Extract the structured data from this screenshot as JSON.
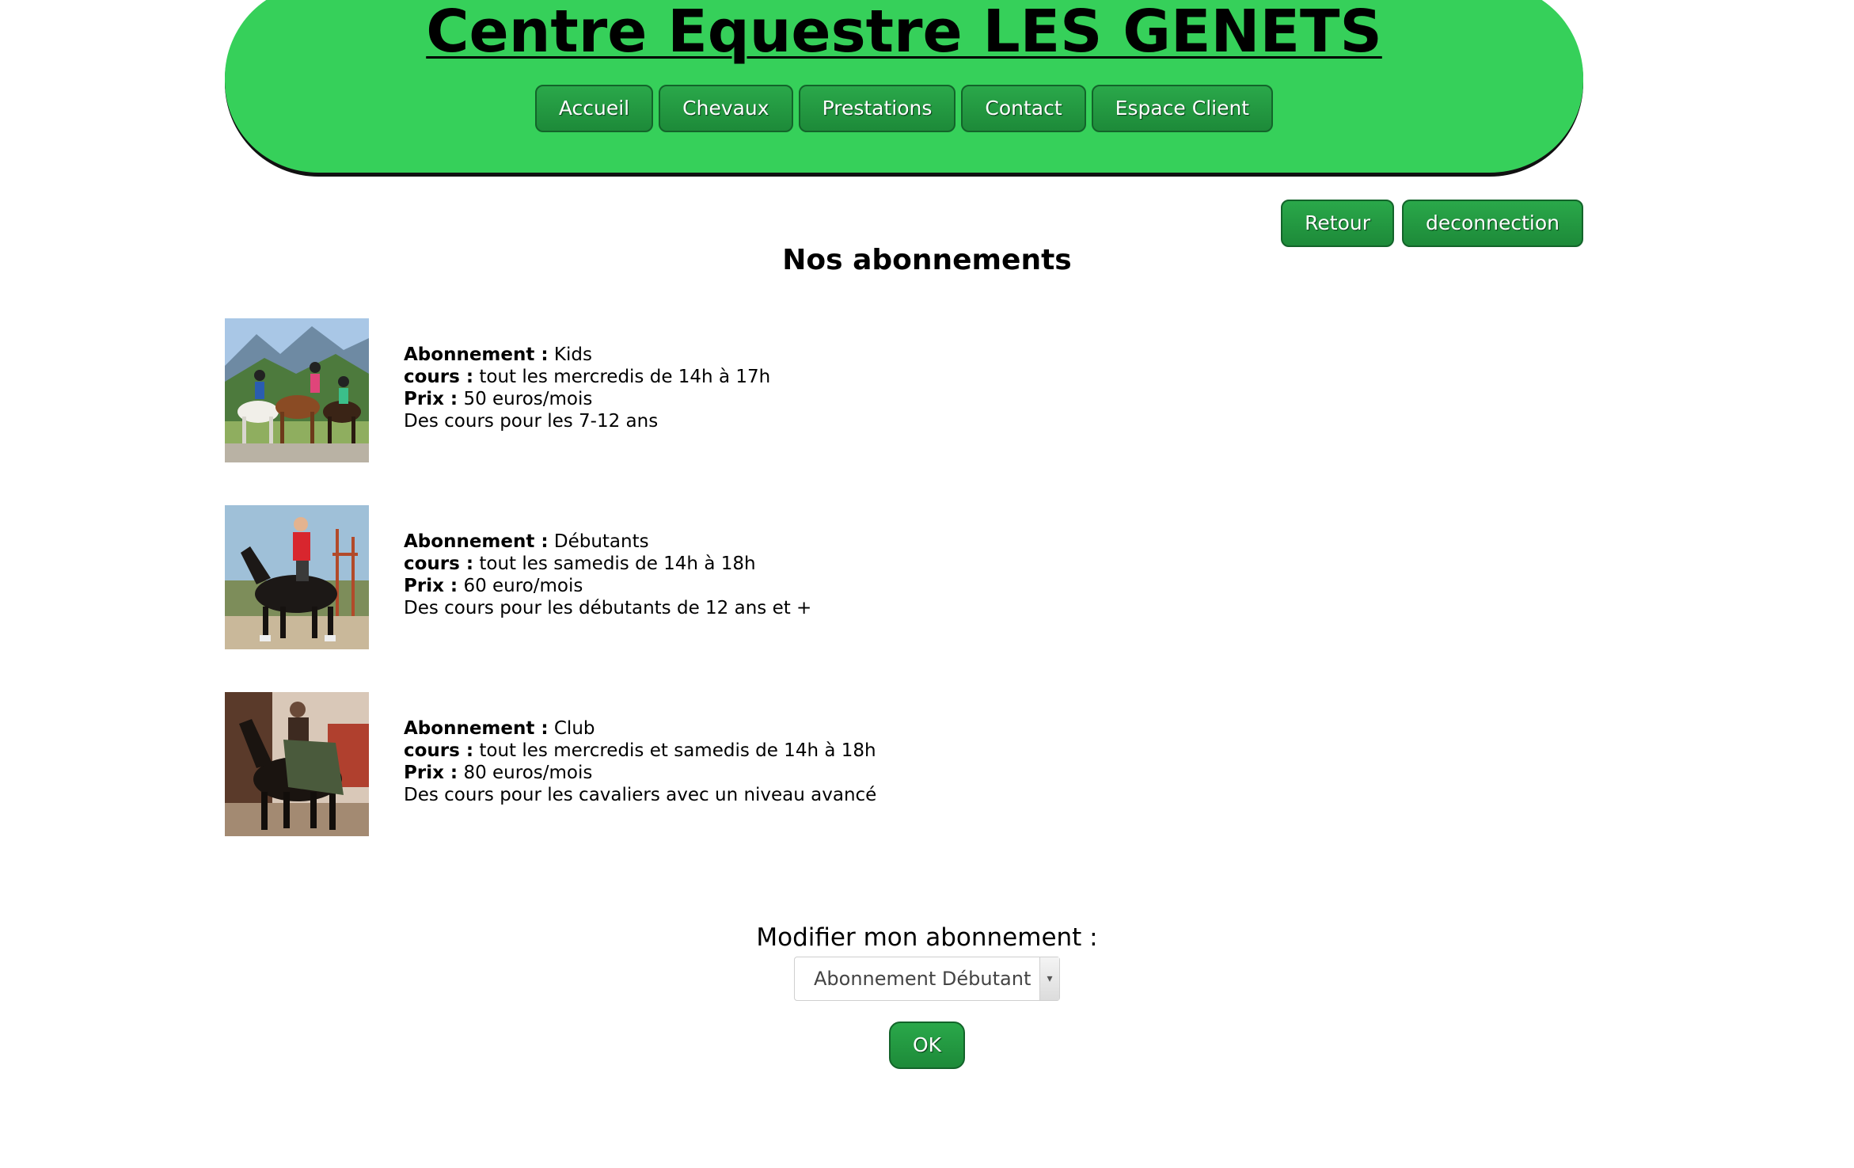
{
  "header": {
    "title": "Centre Equestre LES GENETS",
    "nav": [
      {
        "label": "Accueil"
      },
      {
        "label": "Chevaux"
      },
      {
        "label": "Prestations"
      },
      {
        "label": "Contact"
      },
      {
        "label": "Espace Client"
      }
    ],
    "colors": {
      "banner": "#36d05a",
      "button": "#1f9a3f"
    }
  },
  "actions": {
    "back_label": "Retour",
    "logout_label": "deconnection"
  },
  "main": {
    "title": "Nos abonnements",
    "subscriptions": [
      {
        "image_icon": "kids-riding-ponies-photo",
        "abonnement_label": "Abonnement :",
        "abonnement_value": "Kids",
        "cours_label": "cours :",
        "cours_value": "tout les mercredis de 14h à 17h",
        "prix_label": "Prix :",
        "prix_value": "50 euros/mois",
        "description": "Des cours pour les 7-12 ans"
      },
      {
        "image_icon": "rider-on-black-horse-photo",
        "abonnement_label": "Abonnement :",
        "abonnement_value": "Débutants",
        "cours_label": "cours :",
        "cours_value": "tout les samedis de 14h à 18h",
        "prix_label": "Prix :",
        "prix_value": "60 euro/mois",
        "description": "Des cours pour les débutants de 12 ans et +"
      },
      {
        "image_icon": "warrior-on-horse-photo",
        "abonnement_label": "Abonnement :",
        "abonnement_value": "Club",
        "cours_label": "cours :",
        "cours_value": "tout les mercredis et samedis de 14h à 18h",
        "prix_label": "Prix :",
        "prix_value": "80 euros/mois",
        "description": "Des cours pour les cavaliers avec un niveau avancé"
      }
    ]
  },
  "modify": {
    "label": "Modifier mon abonnement :",
    "selected": "Abonnement Débutant",
    "submit_label": "OK"
  }
}
